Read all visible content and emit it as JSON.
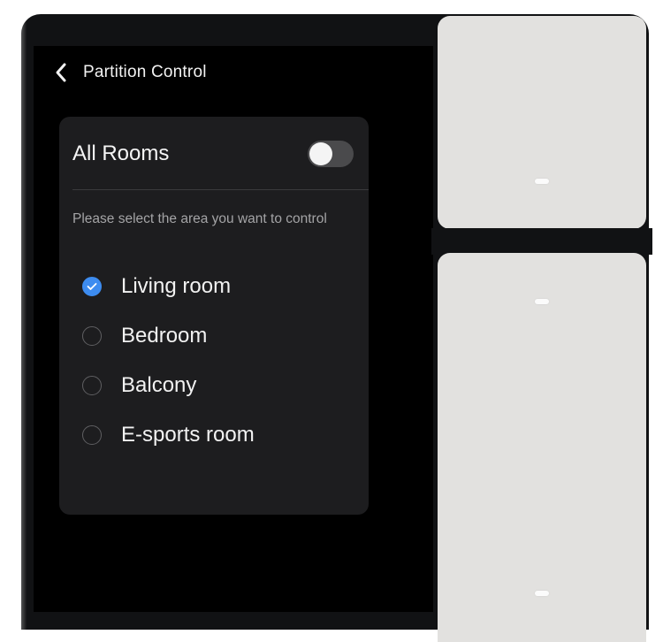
{
  "header": {
    "title": "Partition Control",
    "back_icon": "chevron-left-icon"
  },
  "all_rooms": {
    "label": "All Rooms",
    "toggle_on": false
  },
  "instruction": "Please select the area you want to control",
  "rooms": [
    {
      "label": "Living room",
      "selected": true
    },
    {
      "label": "Bedroom",
      "selected": false
    },
    {
      "label": "Balcony",
      "selected": false
    },
    {
      "label": "E-sports room",
      "selected": false
    }
  ],
  "colors": {
    "accent": "#3d8cf0",
    "card": "#1d1d1f",
    "screen": "#000000",
    "panel": "#e2e1df"
  }
}
